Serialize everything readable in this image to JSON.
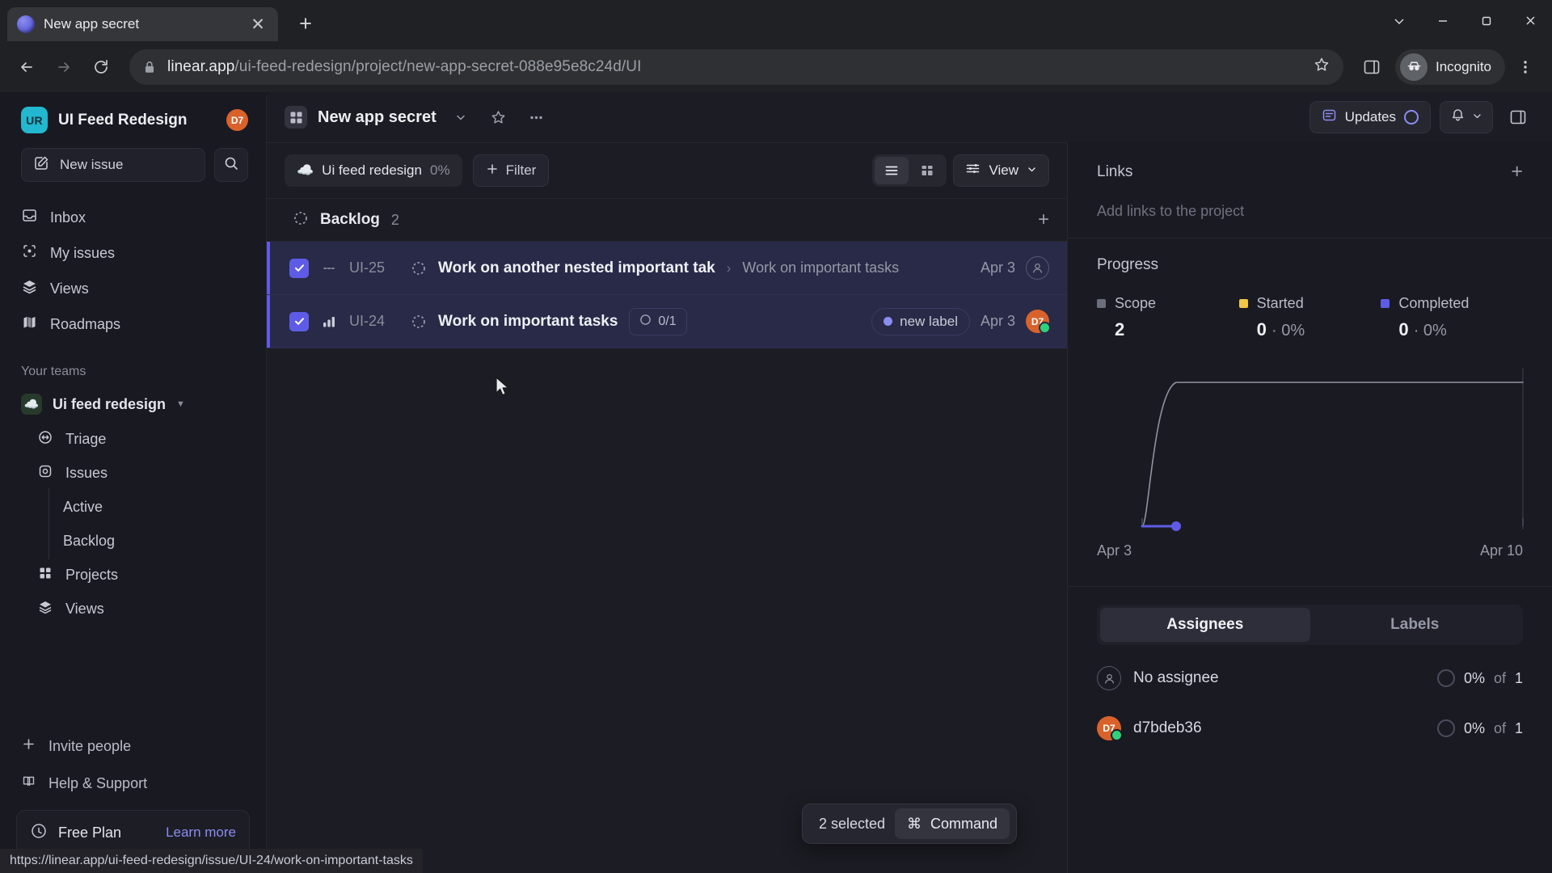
{
  "browser": {
    "tab": {
      "title": "New app secret",
      "favicon_icon": "linear-logo-icon",
      "close_icon": "close-icon"
    },
    "new_tab_icon": "plus-icon",
    "window_controls": {
      "minimize_to_tray": "chevron-down-icon",
      "minimize": "minimize-icon",
      "maximize": "maximize-icon",
      "close": "close-icon"
    },
    "nav": {
      "back_icon": "back-arrow-icon",
      "forward_icon": "forward-arrow-icon",
      "reload_icon": "reload-icon"
    },
    "omnibox": {
      "lock_icon": "lock-icon",
      "url_domain": "linear.app",
      "url_path": "/ui-feed-redesign/project/new-app-secret-088e95e8c24d/UI",
      "bookmark_icon": "star-icon"
    },
    "side_panel_icon": "side-panel-icon",
    "profile": {
      "label": "Incognito",
      "icon": "incognito-icon"
    },
    "menu_icon": "kebab-menu-icon",
    "status_url": "https://linear.app/ui-feed-redesign/issue/UI-24/work-on-important-tasks"
  },
  "sidebar": {
    "workspace": {
      "initials": "UR",
      "name": "UI Feed Redesign",
      "avatar_initials": "D7"
    },
    "new_issue": {
      "label": "New issue",
      "icon": "compose-icon"
    },
    "search_icon": "search-icon",
    "nav": [
      {
        "label": "Inbox",
        "icon": "inbox-icon"
      },
      {
        "label": "My issues",
        "icon": "my-issues-icon"
      },
      {
        "label": "Views",
        "icon": "layers-icon"
      },
      {
        "label": "Roadmaps",
        "icon": "roadmap-icon"
      }
    ],
    "teams_heading": "Your teams",
    "team": {
      "name": "Ui feed redesign",
      "icon": "green-cloud-icon",
      "caret": "chevron-down-icon"
    },
    "team_items": [
      {
        "label": "Triage",
        "icon": "triage-icon"
      },
      {
        "label": "Issues",
        "icon": "issues-icon"
      }
    ],
    "issue_subitems": [
      {
        "label": "Active"
      },
      {
        "label": "Backlog"
      }
    ],
    "team_items_2": [
      {
        "label": "Projects",
        "icon": "grid-icon"
      },
      {
        "label": "Views",
        "icon": "layers-icon"
      }
    ],
    "footer": [
      {
        "label": "Invite people",
        "icon": "plus-icon"
      },
      {
        "label": "Help & Support",
        "icon": "book-icon"
      }
    ],
    "plan": {
      "icon": "plan-icon",
      "name": "Free Plan",
      "link": "Learn more"
    }
  },
  "header": {
    "project_icon": "project-grid-icon",
    "project_name": "New app secret",
    "project_caret": "chevron-down-icon",
    "favorite_icon": "star-icon",
    "more_icon": "ellipsis-icon",
    "updates": {
      "label": "Updates",
      "icon": "updates-icon",
      "status_icon": "progress-circle-icon"
    },
    "notifications_icon": "bell-icon",
    "notifications_caret": "chevron-down-icon",
    "panel_toggle_icon": "right-panel-icon"
  },
  "filter_bar": {
    "chip": {
      "icon": "green-cloud-icon",
      "label": "Ui feed redesign",
      "percent": "0%"
    },
    "filter": {
      "label": "Filter",
      "icon": "plus-icon"
    },
    "view_modes": [
      {
        "name": "list-view",
        "icon": "list-icon",
        "active": true
      },
      {
        "name": "board-view",
        "icon": "board-icon",
        "active": false
      }
    ],
    "view": {
      "label": "View",
      "icon": "sliders-icon",
      "caret": "chevron-down-icon"
    }
  },
  "group": {
    "status_icon": "backlog-circle-icon",
    "name": "Backlog",
    "count": "2",
    "add_icon": "plus-icon"
  },
  "issues": [
    {
      "checked": true,
      "priority_icon": "no-priority-icon",
      "id": "UI-25",
      "state_icon": "backlog-circle-icon",
      "title": "Work on another nested important tak",
      "crumb_separator": "›",
      "parent": "Work on important tasks",
      "date": "Apr 3",
      "avatar": {
        "type": "none",
        "icon": "no-assignee-icon"
      }
    },
    {
      "checked": true,
      "priority_icon": "priority-high-icon",
      "id": "UI-24",
      "state_icon": "backlog-circle-icon",
      "title": "Work on important tasks",
      "sub_count": {
        "icon": "progress-circle-icon",
        "text": "0/1"
      },
      "label": {
        "text": "new label",
        "color": "#8b8df0"
      },
      "date": "Apr 3",
      "avatar": {
        "type": "initials",
        "initials": "D7",
        "color": "#d9622b"
      }
    }
  ],
  "selection_bar": {
    "text": "2 selected",
    "command": {
      "icon": "⌘",
      "label": "Command"
    }
  },
  "right_panel": {
    "links": {
      "title": "Links",
      "add_icon": "plus-icon",
      "empty_text": "Add links to the project"
    },
    "progress": {
      "title": "Progress",
      "stats": [
        {
          "label": "Scope",
          "value": "2",
          "sub": "",
          "color": "#6b6e7d"
        },
        {
          "label": "Started",
          "value": "0",
          "sub": "· 0%",
          "color": "#f2c744"
        },
        {
          "label": "Completed",
          "value": "0",
          "sub": "· 0%",
          "color": "#5e5ce6"
        }
      ]
    },
    "tabs": [
      {
        "label": "Assignees",
        "active": true
      },
      {
        "label": "Labels",
        "active": false
      }
    ],
    "assignees": [
      {
        "name": "No assignee",
        "avatar_type": "none",
        "percent": "0%",
        "of": "of",
        "total": "1"
      },
      {
        "name": "d7bdeb36",
        "avatar_type": "initials",
        "initials": "D7",
        "percent": "0%",
        "of": "of",
        "total": "1"
      }
    ]
  },
  "chart_data": {
    "type": "line",
    "title": "Progress",
    "x": [
      "Apr 3",
      "Apr 10"
    ],
    "xlabel": "",
    "ylabel": "",
    "series": [
      {
        "name": "Scope",
        "color": "#8f93a3",
        "values": [
          0,
          2
        ]
      },
      {
        "name": "Started",
        "color": "#f2c744",
        "values": [
          0,
          0
        ]
      },
      {
        "name": "Completed",
        "color": "#5e5ce6",
        "values": [
          0,
          0
        ]
      }
    ],
    "ylim": [
      0,
      2
    ],
    "grid": false,
    "legend": "top"
  }
}
